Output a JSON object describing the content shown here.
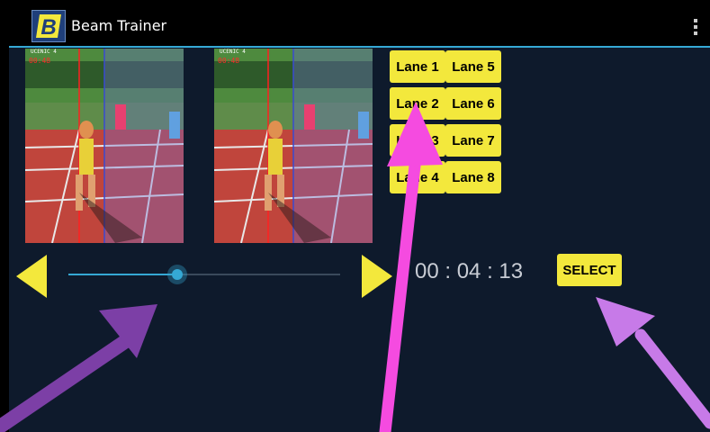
{
  "app": {
    "title": "Beam Trainer",
    "icon_letter": "B",
    "icon": "app-logo-icon",
    "overflow_icon": "overflow-menu-icon",
    "accent_color": "#35a8d4",
    "bar_color": "#000000"
  },
  "frames": [
    {
      "label": "UČENIC 4",
      "timecode": "00:48"
    },
    {
      "label": "UČENIC 4",
      "timecode": "00:48"
    }
  ],
  "lanes": [
    "Lane 1",
    "Lane 5",
    "Lane 2",
    "Lane 6",
    "Lane 3",
    "Lane 7",
    "Lane 4",
    "Lane 8"
  ],
  "player": {
    "prev_icon": "previous-triangle-icon",
    "next_icon": "next-triangle-icon",
    "seek_progress": 0.4,
    "time": "00 : 04 : 13",
    "select_label": "SELECT"
  },
  "colors": {
    "button_yellow": "#f3e83c",
    "background": "#0e1a2c",
    "annotation_purple": "#7c3fa6",
    "annotation_magenta": "#f54be0",
    "annotation_violet": "#c77ae8"
  }
}
